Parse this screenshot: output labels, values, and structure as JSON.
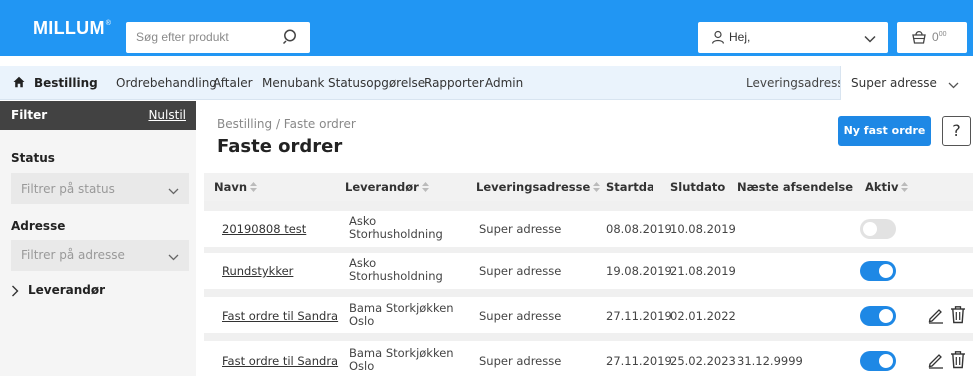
{
  "header": {
    "logo": "MILLUM",
    "logo_mark": "®",
    "search_placeholder": "Søg efter produkt",
    "user_greeting": "Hej,",
    "cart_amount": "0",
    "cart_amount_sup": "00",
    "brand_color": "#2196f3"
  },
  "nav": {
    "items": [
      {
        "label": "Bestilling",
        "active": true
      },
      {
        "label": "Ordrebehandling",
        "active": false
      },
      {
        "label": "Aftaler",
        "active": false
      },
      {
        "label": "Menubank",
        "active": false
      },
      {
        "label": "Statusopgørelse",
        "active": false
      },
      {
        "label": "Rapporter",
        "active": false
      },
      {
        "label": "Admin",
        "active": false
      }
    ],
    "delivery_label": "Leveringsadresse:",
    "delivery_value": "Super adresse"
  },
  "sidebar": {
    "filter_title": "Filter",
    "reset_label": "Nulstil",
    "status_label": "Status",
    "status_placeholder": "Filtrer på status",
    "address_label": "Adresse",
    "address_placeholder": "Filtrer på adresse",
    "supplier_label": "Leverandør"
  },
  "main": {
    "breadcrumb": "Bestilling / Faste ordrer",
    "title": "Faste ordrer",
    "new_button": "Ny fast ordre",
    "help_button": "?",
    "columns": [
      "Navn",
      "Leverandør",
      "Leveringsadresse",
      "Startdatı",
      "Slutdato",
      "Næste afsendelse",
      "Aktiv"
    ],
    "rows": [
      {
        "name": "20190808 test",
        "supplier_1": "Asko",
        "supplier_2": "Storhusholdning",
        "address": "Super adresse",
        "start": "08.08.2019",
        "end": "10.08.2019",
        "next": "",
        "active": false,
        "actions": false
      },
      {
        "name": "Rundstykker",
        "supplier_1": "Asko",
        "supplier_2": "Storhusholdning",
        "address": "Super adresse",
        "start": "19.08.2019",
        "end": "21.08.2019",
        "next": "",
        "active": true,
        "actions": false
      },
      {
        "name": "Fast ordre til Sandra",
        "supplier_1": "Bama Storkjøkken",
        "supplier_2": "Oslo",
        "address": "Super adresse",
        "start": "27.11.2019",
        "end": "02.01.2022",
        "next": "",
        "active": true,
        "actions": true
      },
      {
        "name": "Fast ordre til Sandra",
        "supplier_1": "Bama Storkjøkken",
        "supplier_2": "Oslo",
        "address": "Super adresse",
        "start": "27.11.2019",
        "end": "25.02.2023",
        "next": "31.12.9999",
        "active": true,
        "actions": true
      }
    ]
  }
}
